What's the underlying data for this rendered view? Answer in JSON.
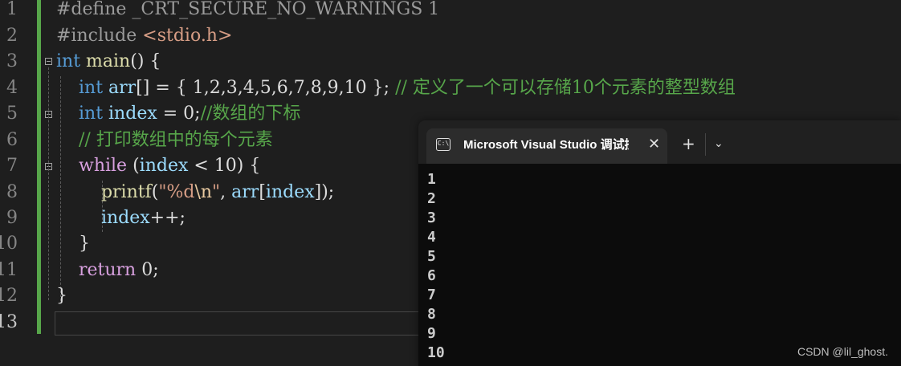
{
  "editor": {
    "line_numbers": [
      "1",
      "2",
      "3",
      "4",
      "5",
      "6",
      "7",
      "8",
      "9",
      "10",
      "11",
      "12",
      "13"
    ],
    "lines": {
      "l1": {
        "directive": "#define",
        "rest": " _CRT_SECURE_NO_WARNINGS 1"
      },
      "l2": {
        "directive": "#include",
        "header": " <stdio.h>"
      },
      "l3": {
        "type": "int",
        "name": " main",
        "rest": "() {"
      },
      "l4": {
        "indent": "    ",
        "type": "int",
        "var": " arr",
        "rest": "[] = { 1,2,3,4,5,6,7,8,9,10 };",
        "comment": " // 定义了一个可以存储10个元素的整型数组"
      },
      "l5": {
        "indent": "    ",
        "type": "int",
        "var": " index",
        "rest": " = 0;",
        "comment": "//数组的下标"
      },
      "l6": {
        "indent": "    ",
        "comment": "// 打印数组中的每个元素"
      },
      "l7": {
        "indent": "    ",
        "kw": "while",
        "p1": " (",
        "var": "index",
        "p2": " < 10) {"
      },
      "l8": {
        "indent": "        ",
        "fn": "printf",
        "p1": "(",
        "str1": "\"%d",
        "esc": "\\n",
        "str2": "\"",
        "p2": ", ",
        "var1": "arr",
        "p3": "[",
        "var2": "index",
        "p4": "]);"
      },
      "l9": {
        "indent": "        ",
        "var": "index",
        "rest": "++;"
      },
      "l10": {
        "indent": "    ",
        "rest": "}"
      },
      "l11": {
        "indent": "    ",
        "kw": "return",
        "rest": " 0;"
      },
      "l12": {
        "rest": "}"
      }
    }
  },
  "console": {
    "tab_title": "Microsoft Visual Studio 调试控制台",
    "tab_icon": "C:\\",
    "close_glyph": "✕",
    "new_tab_glyph": "+",
    "dropdown_glyph": "⌄",
    "output": [
      "1",
      "2",
      "3",
      "4",
      "5",
      "6",
      "7",
      "8",
      "9",
      "10"
    ]
  },
  "watermark": "CSDN @lil_ghost.",
  "colors": {
    "comment": "#57a64a",
    "keyword": "#569cd6",
    "control": "#d8a0df",
    "variable": "#9cdcfe",
    "function": "#dcdcaa"
  }
}
